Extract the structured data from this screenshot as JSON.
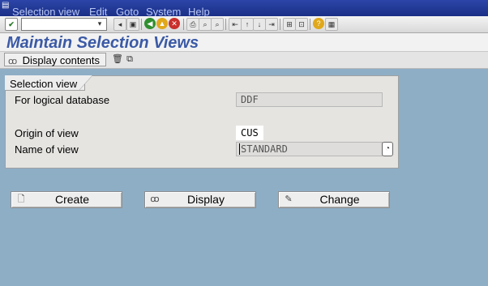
{
  "menu": {
    "items": [
      "Selection view",
      "Edit",
      "Goto",
      "System",
      "Help"
    ]
  },
  "system_toolbar": {
    "command_value": "",
    "icons": [
      "enter-icon",
      "save-icon",
      "back-icon",
      "exit-icon",
      "cancel-icon",
      "print-icon",
      "find-icon",
      "find-next-icon",
      "first-page-icon",
      "prev-page-icon",
      "next-page-icon",
      "last-page-icon",
      "create-session-icon",
      "shortcut-icon",
      "help-icon",
      "layout-icon"
    ]
  },
  "title": "Maintain Selection Views",
  "app_toolbar": {
    "display_contents_label": "Display contents",
    "icons": [
      "delete-icon",
      "copy-icon"
    ]
  },
  "group": {
    "title": "Selection view",
    "fields": [
      {
        "label": "For logical database",
        "value": "DDF",
        "editable": false
      },
      {
        "label": "Origin of view",
        "value": "CUS",
        "editable": true
      },
      {
        "label": "Name of view",
        "value": "STANDARD",
        "editable": false
      }
    ]
  },
  "buttons": [
    {
      "label": "Create",
      "icon": "new-document-icon"
    },
    {
      "label": "Display",
      "icon": "glasses-icon"
    },
    {
      "label": "Change",
      "icon": "pencil-icon"
    }
  ],
  "colors": {
    "menubar": "#1a2f86",
    "title": "#3b5aa6",
    "background": "#8eaec6"
  }
}
